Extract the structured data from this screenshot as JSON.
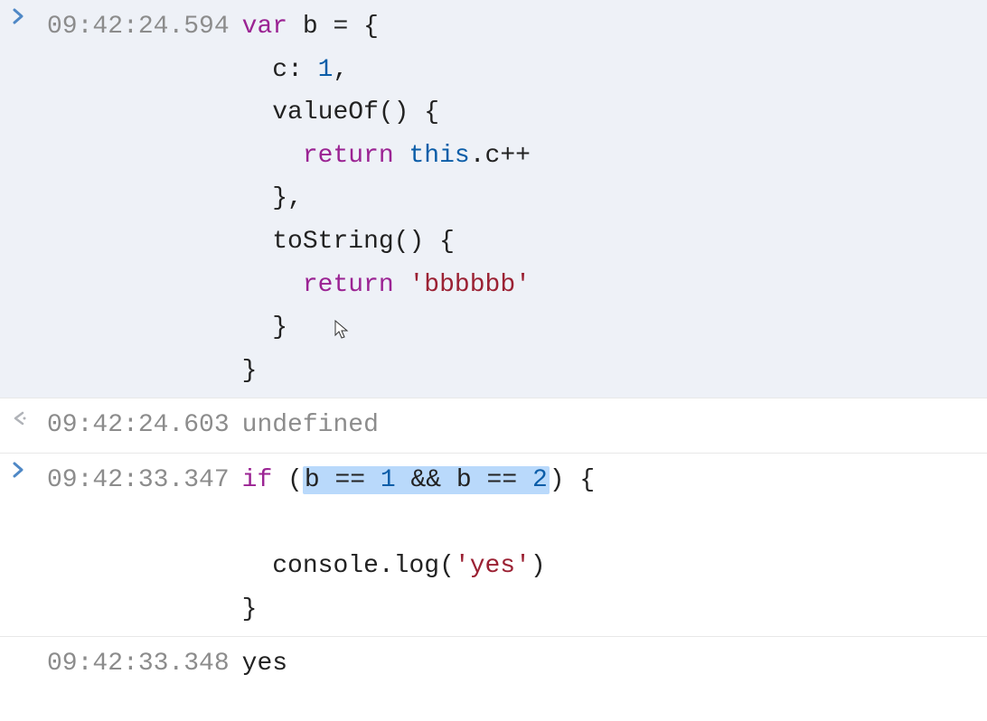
{
  "entries": [
    {
      "type": "input",
      "timestamp": "09:42:24.594",
      "code": {
        "lines": [
          [
            {
              "t": "kw",
              "v": "var"
            },
            {
              "t": "punct",
              "v": " b = {"
            }
          ],
          [
            {
              "t": "indent",
              "v": "  "
            },
            {
              "t": "prop",
              "v": "c"
            },
            {
              "t": "punct",
              "v": ": "
            },
            {
              "t": "num",
              "v": "1"
            },
            {
              "t": "punct",
              "v": ","
            }
          ],
          [
            {
              "t": "indent",
              "v": "  "
            },
            {
              "t": "prop",
              "v": "valueOf"
            },
            {
              "t": "punct",
              "v": "() {"
            }
          ],
          [
            {
              "t": "indent",
              "v": "    "
            },
            {
              "t": "kw",
              "v": "return"
            },
            {
              "t": "punct",
              "v": " "
            },
            {
              "t": "this",
              "v": "this"
            },
            {
              "t": "punct",
              "v": ".c++"
            }
          ],
          [
            {
              "t": "indent",
              "v": "  "
            },
            {
              "t": "punct",
              "v": "},"
            }
          ],
          [
            {
              "t": "indent",
              "v": "  "
            },
            {
              "t": "prop",
              "v": "toString"
            },
            {
              "t": "punct",
              "v": "() {"
            }
          ],
          [
            {
              "t": "indent",
              "v": "    "
            },
            {
              "t": "kw",
              "v": "return"
            },
            {
              "t": "punct",
              "v": " "
            },
            {
              "t": "str",
              "v": "'bbbbbb'"
            }
          ],
          [
            {
              "t": "indent",
              "v": "  "
            },
            {
              "t": "punct",
              "v": "}"
            }
          ],
          [
            {
              "t": "punct",
              "v": "}"
            }
          ]
        ]
      }
    },
    {
      "type": "output",
      "timestamp": "09:42:24.603",
      "value": "undefined"
    },
    {
      "type": "input",
      "timestamp": "09:42:33.347",
      "code": {
        "lines": [
          [
            {
              "t": "kw",
              "v": "if"
            },
            {
              "t": "punct",
              "v": " ("
            },
            {
              "t": "hl",
              "children": [
                {
                  "t": "ident",
                  "v": "b "
                },
                {
                  "t": "punct",
                  "v": "== "
                },
                {
                  "t": "num",
                  "v": "1"
                },
                {
                  "t": "punct",
                  "v": " && b == "
                },
                {
                  "t": "num",
                  "v": "2"
                }
              ]
            },
            {
              "t": "punct",
              "v": ") {"
            }
          ],
          [
            {
              "t": "indent",
              "v": ""
            }
          ],
          [
            {
              "t": "indent",
              "v": "  "
            },
            {
              "t": "ident",
              "v": "console"
            },
            {
              "t": "punct",
              "v": ".log("
            },
            {
              "t": "str",
              "v": "'yes'"
            },
            {
              "t": "punct",
              "v": ")"
            }
          ],
          [
            {
              "t": "punct",
              "v": "}"
            }
          ]
        ]
      }
    },
    {
      "type": "log",
      "timestamp": "09:42:33.348",
      "value": "yes"
    }
  ],
  "colors": {
    "keyword": "#9b2393",
    "number": "#0b5da8",
    "string": "#9b2133",
    "timestamp": "#8c8c8c",
    "arrow_in": "#4f88c6",
    "arrow_out": "#9aa0a6",
    "highlight_bg": "#b9d9fb",
    "input_bg": "#eef1f7"
  }
}
